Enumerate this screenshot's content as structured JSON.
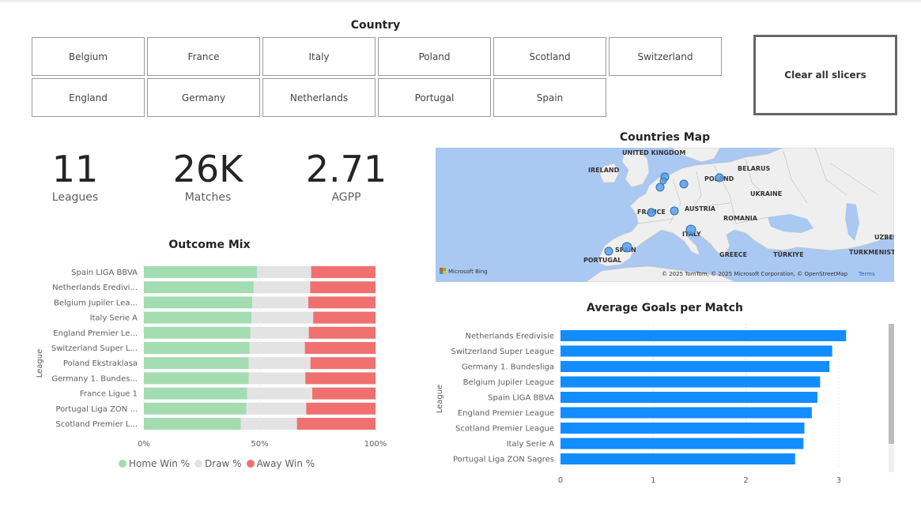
{
  "slicer": {
    "title": "Country",
    "options": [
      "Belgium",
      "France",
      "Italy",
      "Poland",
      "Scotland",
      "Switzerland",
      "England",
      "Germany",
      "Netherlands",
      "Portugal",
      "Spain"
    ],
    "clear_label": "Clear all slicers"
  },
  "kpis": [
    {
      "value": "11",
      "label": "Leagues"
    },
    {
      "value": "26K",
      "label": "Matches"
    },
    {
      "value": "2.71",
      "label": "AGPP"
    }
  ],
  "map": {
    "title": "Countries Map",
    "labels": [
      "UNITED KINGDOM",
      "IRELAND",
      "POLAND",
      "BELARUS",
      "UKRAINE",
      "FRANCE",
      "AUSTRIA",
      "ROMANIA",
      "ITALY",
      "SPAIN",
      "PORTUGAL",
      "GREECE",
      "TÜRKIYE",
      "TURKMENISTA",
      "UZBEK"
    ],
    "attribution": "© 2025 TomTom, © 2025 Microsoft Corporation, © OpenStreetMap",
    "terms": "Terms",
    "provider": "Microsoft Bing",
    "colors": {
      "water": "#a9c8f2",
      "land": "#efefef",
      "marker": "#5a9fe6"
    }
  },
  "outcome_mix": {
    "title": "Outcome Mix",
    "ylabel": "League",
    "ticks": [
      "0%",
      "50%",
      "100%"
    ],
    "legend": [
      "Home Win %",
      "Draw %",
      "Away Win %"
    ],
    "colors": {
      "home": "#a3dcb0",
      "draw": "#e3e3e3",
      "away": "#f07070"
    }
  },
  "avg_goals": {
    "title": "Average Goals per Match",
    "ylabel": "League",
    "ticks": [
      "0",
      "1",
      "2",
      "3"
    ],
    "color": "#118dff"
  },
  "chart_data": [
    {
      "type": "bar",
      "title": "Outcome Mix",
      "ylabel": "League",
      "orientation": "horizontal-stacked-100",
      "categories": [
        "Spain LIGA BBVA",
        "Netherlands Eredivi...",
        "Belgium Jupiler Lea...",
        "Italy Serie A",
        "England Premier Le...",
        "Switzerland Super L...",
        "Poland Ekstraklasa",
        "Germany 1. Bundes...",
        "France Ligue 1",
        "Portugal Liga ZON ...",
        "Scotland Premier L..."
      ],
      "series": [
        {
          "name": "Home Win %",
          "values": [
            48.8,
            47.4,
            46.8,
            46.5,
            45.9,
            45.6,
            45.3,
            45.3,
            44.6,
            44.2,
            41.8
          ]
        },
        {
          "name": "Draw %",
          "values": [
            23.4,
            24.4,
            24.2,
            26.6,
            25.3,
            23.9,
            26.6,
            24.4,
            28.1,
            25.9,
            24.3
          ]
        },
        {
          "name": "Away Win %",
          "values": [
            27.8,
            28.2,
            29.0,
            26.9,
            28.8,
            30.5,
            28.1,
            30.3,
            27.3,
            29.9,
            33.9
          ]
        }
      ],
      "xlim": [
        0,
        100
      ],
      "legend": "bottom"
    },
    {
      "type": "bar",
      "title": "Average Goals per Match",
      "ylabel": "League",
      "orientation": "horizontal",
      "categories": [
        "Netherlands Eredivisie",
        "Switzerland Super League",
        "Germany 1. Bundesliga",
        "Belgium Jupiler League",
        "Spain LIGA BBVA",
        "England Premier League",
        "Scotland Premier League",
        "Italy Serie A",
        "Portugal Liga ZON Sagres"
      ],
      "values": [
        3.08,
        2.93,
        2.9,
        2.8,
        2.77,
        2.71,
        2.63,
        2.62,
        2.53
      ],
      "xlim": [
        0,
        3.2
      ]
    }
  ]
}
